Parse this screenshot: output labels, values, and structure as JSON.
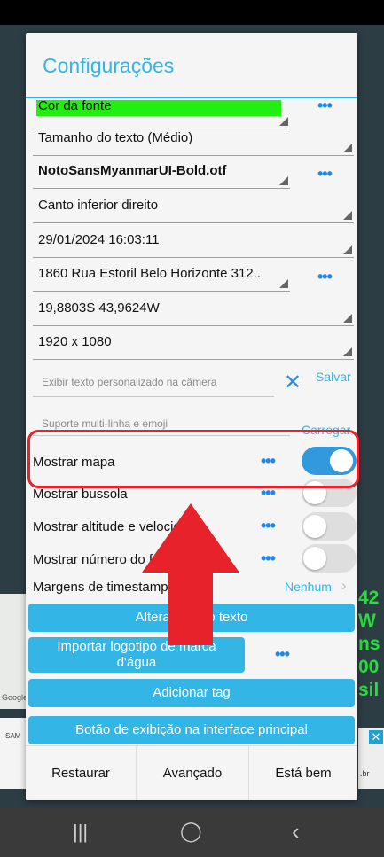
{
  "dialog": {
    "title": "Configurações",
    "rows": {
      "font_color": "Cor da fonte",
      "text_size": "Tamanho do texto (Médio)",
      "font_file": "NotoSansMyanmarUI-Bold.otf",
      "position": "Canto inferior direito",
      "datetime": "29/01/2024 16:03:11",
      "address": "1860 Rua Estoril Belo Horizonte 312..",
      "coordinates": "19,8803S 43,9624W",
      "resolution": "1920 x 1080"
    },
    "custom_text_placeholder": "Exibir texto personalizado na câmera",
    "save_label": "Salvar",
    "multiline_placeholder": "Suporte multi-linha e emoji",
    "load_label": "Carregar",
    "toggles": {
      "show_map": "Mostrar mapa",
      "show_compass": "Mostrar bussola",
      "show_altitude": "Mostrar altitude e velocidade",
      "show_number": "Mostrar número do f"
    },
    "margins_label": "Margens de timestamp",
    "margins_value": "Nenhum",
    "buttons": {
      "change_text": "Alterar cor do texto",
      "import_logo_line1": "Importar logotipo de marca",
      "import_logo_line2": "d'água",
      "add_tag": "Adicionar tag",
      "display_button": "Botão de exibição na interface principal"
    },
    "footer": {
      "restore": "Restaurar",
      "advanced": "Avançado",
      "ok": "Está bem"
    }
  },
  "background": {
    "right_text": [
      "42",
      "W",
      "ns",
      "00",
      "sil"
    ],
    "google": "Google",
    "ad_brand": "SAM",
    "ad_domain": ".br"
  },
  "colors": {
    "accent": "#33b5e5",
    "font_color_swatch": "#22ee11",
    "toggle_on": "#3399dd",
    "highlight": "#e8222a"
  },
  "toggle_states": {
    "show_map": true,
    "show_compass": false,
    "show_altitude": false,
    "show_number": false
  }
}
